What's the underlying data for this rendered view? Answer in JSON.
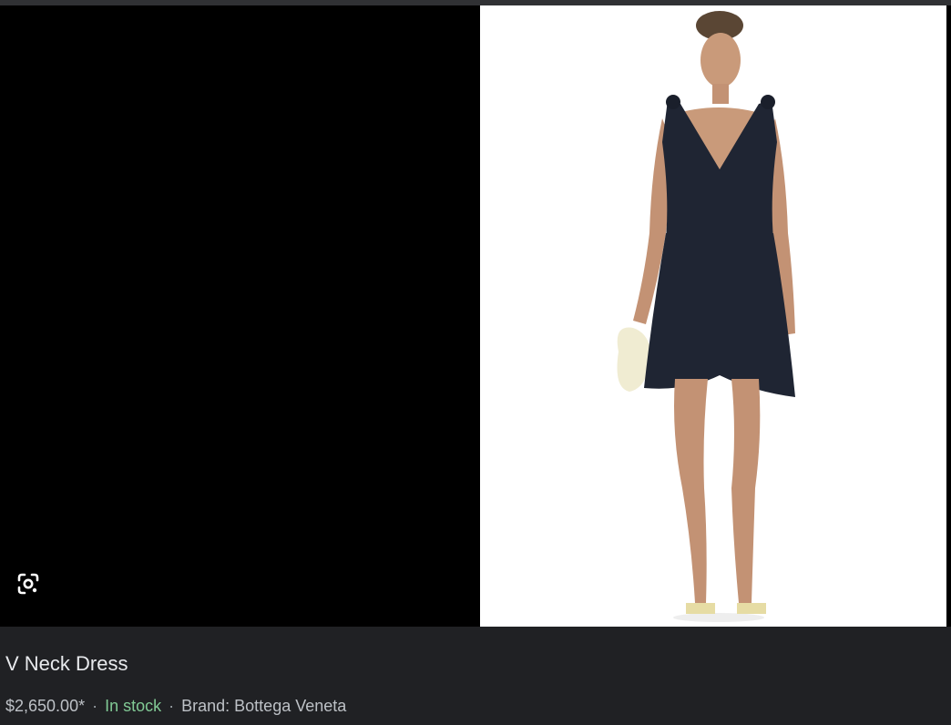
{
  "product": {
    "title": "V Neck Dress",
    "price": "$2,650.00*",
    "separator": "·",
    "availability": "In stock",
    "brand_label": "Brand: Bottega Veneta"
  },
  "icons": {
    "lens": "google-lens-icon"
  },
  "colors": {
    "background": "#202124",
    "viewer": "#000000",
    "stock": "#81c995",
    "title": "#e8eaed",
    "meta": "#bdc1c6"
  }
}
